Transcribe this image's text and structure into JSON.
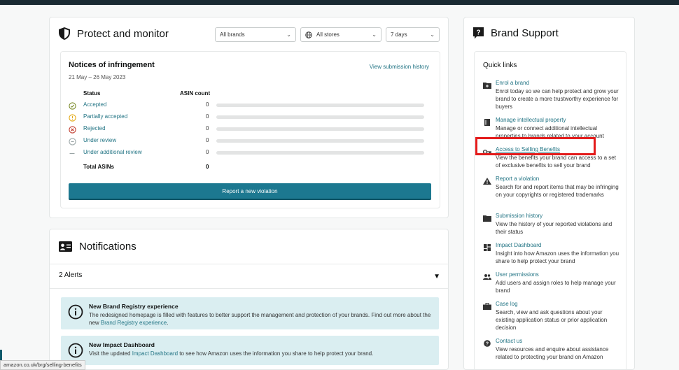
{
  "protect": {
    "title": "Protect and monitor",
    "filters": {
      "brand": "All brands",
      "store": "All stores",
      "range": "7 days"
    },
    "notices": {
      "title": "Notices of infringement",
      "date_range": "21 May – 26 May 2023",
      "view_history": "View submission history",
      "col_status": "Status",
      "col_count": "ASIN count",
      "rows": [
        {
          "label": "Accepted",
          "count": "0",
          "icon": "check-circle-icon",
          "color": "#7a8b2a"
        },
        {
          "label": "Partially accepted",
          "count": "0",
          "icon": "alert-circle-icon",
          "color": "#e3a915"
        },
        {
          "label": "Rejected",
          "count": "0",
          "icon": "x-circle-icon",
          "color": "#c0392b"
        },
        {
          "label": "Under review",
          "count": "0",
          "icon": "minus-circle-icon",
          "color": "#9aa5a6"
        },
        {
          "label": "Under additional review",
          "count": "0",
          "icon": "dash-icon",
          "color": "#9aa5a6"
        }
      ],
      "total_label": "Total ASINs",
      "total_count": "0",
      "report_button": "Report a new violation"
    }
  },
  "notifications": {
    "title": "Notifications",
    "alerts_label": "2 Alerts",
    "alerts_toggle": "▼",
    "items": [
      {
        "title": "New Brand Registry experience",
        "body_pre": "The redesigned homepage is filled with features to better support the management and protection of your brands. Find out more about the new ",
        "link": "Brand Registry experience",
        "body_post": "."
      },
      {
        "title": "New Impact Dashboard",
        "body_pre": "Visit the updated ",
        "link": "Impact Dashboard",
        "body_post": " to see how Amazon uses the information you share to help protect your brand."
      }
    ]
  },
  "support": {
    "title": "Brand Support",
    "quick_links_title": "Quick links",
    "items": [
      {
        "link": "Enrol a brand",
        "desc": "Enrol today so we can help protect and grow your brand to create a more trustworthy experience for buyers",
        "icon": "folder-plus-icon"
      },
      {
        "link": "Manage intellectual property",
        "desc": "Manage or connect additional intellectual properties to brands related to your account",
        "icon": "book-icon"
      },
      {
        "link": "Access to Selling Benefits",
        "desc": "View the benefits your brand can access to a set of exclusive benefits to sell your brand",
        "icon": "key-icon"
      },
      {
        "link": "Report a violation",
        "desc": "Search for and report items that may be infringing on your copyrights or registered trademarks",
        "icon": "warning-icon"
      },
      {
        "link": "Submission history",
        "desc": "View the history of your reported violations and their status",
        "icon": "folder-icon"
      },
      {
        "link": "Impact Dashboard",
        "desc": "Insight into how Amazon uses the information you share to help protect your brand",
        "icon": "dashboard-icon"
      },
      {
        "link": "User permissions",
        "desc": "Add users and assign roles to help manage your brand",
        "icon": "users-icon"
      },
      {
        "link": "Case log",
        "desc": "Search, view and ask questions about your existing application status or prior application decision",
        "icon": "briefcase-icon"
      },
      {
        "link": "Contact us",
        "desc": "View resources and enquire about assistance related to protecting your brand on Amazon",
        "icon": "help-circle-icon"
      }
    ]
  },
  "status_bar_url": "amazon.co.uk/brg/selling-benefits",
  "colors": {
    "accent": "#227484",
    "button": "#1c7890",
    "highlight": "#e31b1b",
    "alert_bg": "#daeef1"
  }
}
